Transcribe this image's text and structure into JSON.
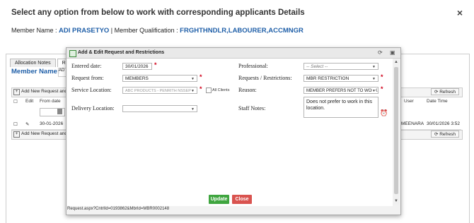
{
  "outer": {
    "title": "Select any option from below to work with corresponding applicants Details",
    "close_icon": "×",
    "member_name_label": "Member Name : ",
    "member_name": "ADI PRASETYO",
    "separator": " | Member Qualification : ",
    "qualification": "FRGHTHNDLR,LABOURER,ACCMNGR"
  },
  "background": {
    "tabs": [
      "Allocation Notes",
      "Re"
    ],
    "member_label": "Member Name:",
    "member_input": "AD",
    "add_new_label": "Add New Request and",
    "refresh_label": "Refresh",
    "headers": {
      "edit": "Edit",
      "from_date": "From date",
      "user": "User",
      "date_time": "Date Time"
    },
    "row": {
      "from_date": "30-01-2026",
      "user": "MEENARA",
      "date_time": "30/01/2026 3:52"
    }
  },
  "dialog": {
    "title": "Add & Edit Request and Restrictions",
    "refresh_icon": "⟳",
    "maximize_icon": "▣",
    "labels": {
      "entered_date": "Entered date:",
      "request_from": "Request from:",
      "service_location": "Service Location:",
      "delivery_location": "Delivery Location:",
      "professional": "Professional:",
      "requests_restrictions": "Requests / Restrictions:",
      "reason": "Reason:",
      "staff_notes": "Staff Notes:",
      "all_clients": "All Clients"
    },
    "values": {
      "entered_date": "30/01/2026",
      "request_from": "MEMBERS",
      "service_location": "ABC PRODUCTS - PENRITH NSSEP",
      "delivery_location": "",
      "professional": "-- Select --",
      "requests_restrictions": "MBR RESTRICTION",
      "reason": "MEMBER PREFERS NOT TO WORK",
      "staff_notes": "Does not prefer to work in this location."
    },
    "buttons": {
      "update": "Update",
      "close": "Close"
    },
    "status_url": "Request.aspx?CntrlId=0193862&MbrId=MBR0002148"
  }
}
